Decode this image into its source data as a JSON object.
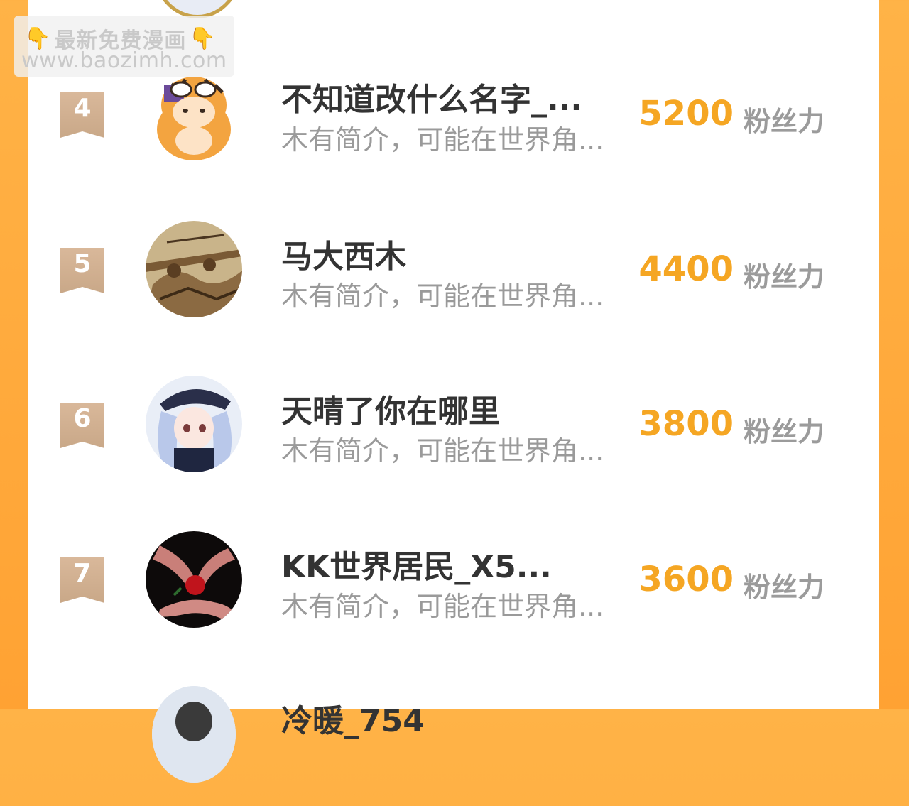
{
  "watermark": {
    "line1": "最新免费漫画",
    "line2": "www.baozimh.com",
    "hand_icon": "👇"
  },
  "fans_label": "粉丝力",
  "rows": [
    {
      "rank": "4",
      "name": "不知道改什么名字_...",
      "bio": "木有简介，可能在世界角...",
      "fans": "5200",
      "avatar_icon": "tiger-costume-avatar"
    },
    {
      "rank": "5",
      "name": "马大西木",
      "bio": "木有简介，可能在世界角...",
      "fans": "4400",
      "avatar_icon": "sepia-soldiers-avatar"
    },
    {
      "rank": "6",
      "name": "天晴了你在哪里",
      "bio": "木有简介，可能在世界角...",
      "fans": "3800",
      "avatar_icon": "anime-girl-cap-avatar"
    },
    {
      "rank": "7",
      "name": "KK世界居民_X5...",
      "bio": "木有简介，可能在世界角...",
      "fans": "3600",
      "avatar_icon": "hands-rose-avatar"
    },
    {
      "rank": "",
      "name": "冷暖_754",
      "bio": "",
      "fans": "",
      "avatar_icon": "person-avatar"
    }
  ],
  "colors": {
    "background": "#ffa233",
    "fans_number": "#f5a623",
    "rank_badge": "#d9b89a",
    "name": "#333333",
    "bio": "#9a9a9a"
  }
}
